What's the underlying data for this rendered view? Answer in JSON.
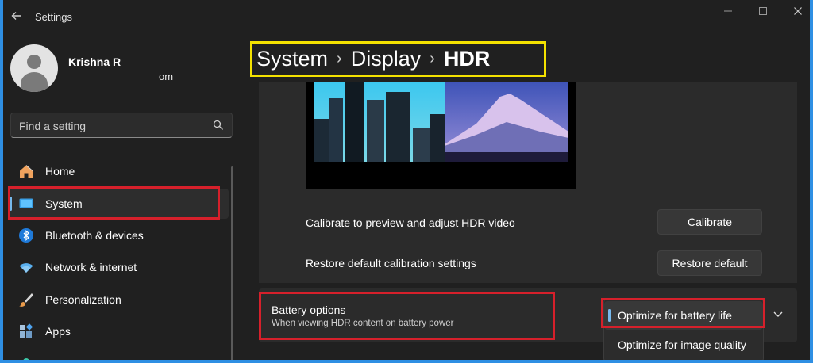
{
  "window": {
    "title": "Settings"
  },
  "user": {
    "name": "Krishna R",
    "email_fragment": "om"
  },
  "search": {
    "placeholder": "Find a setting"
  },
  "sidebar": {
    "items": [
      {
        "label": "Home",
        "icon": "home-icon"
      },
      {
        "label": "System",
        "icon": "system-icon",
        "active": true
      },
      {
        "label": "Bluetooth & devices",
        "icon": "bluetooth-icon"
      },
      {
        "label": "Network & internet",
        "icon": "wifi-icon"
      },
      {
        "label": "Personalization",
        "icon": "brush-icon"
      },
      {
        "label": "Apps",
        "icon": "apps-icon"
      }
    ]
  },
  "breadcrumb": {
    "items": [
      "System",
      "Display",
      "HDR"
    ]
  },
  "calibration": {
    "calibrate_text": "Calibrate to preview and adjust HDR video",
    "calibrate_button": "Calibrate",
    "restore_text": "Restore default calibration settings",
    "restore_button": "Restore default"
  },
  "battery": {
    "title": "Battery options",
    "subtitle": "When viewing HDR content on battery power",
    "options": [
      "Optimize for battery life",
      "Optimize for image quality"
    ],
    "selected": "Optimize for battery life"
  },
  "colors": {
    "highlight_red": "#d6202b",
    "highlight_yellow": "#f3e100",
    "accent": "#76b9ed",
    "frame": "#2f8fe3"
  }
}
